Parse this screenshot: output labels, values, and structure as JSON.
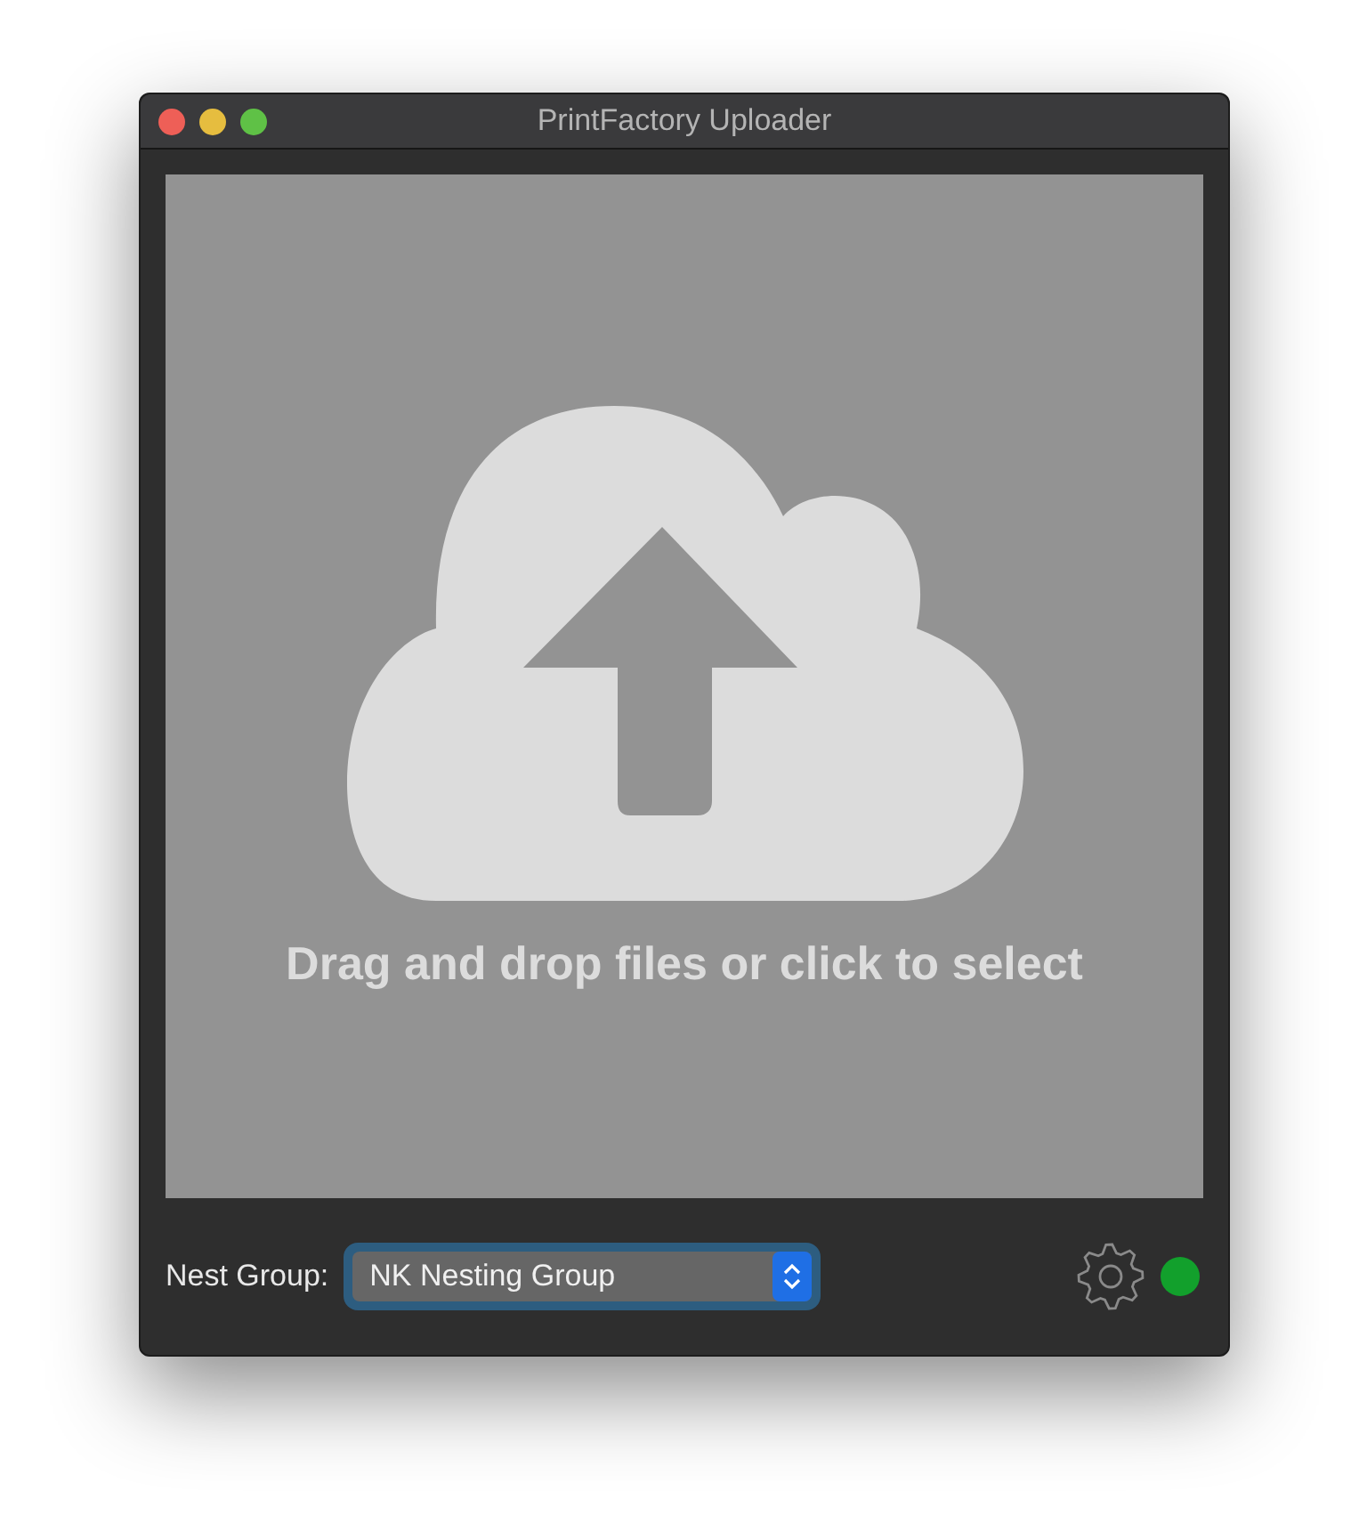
{
  "window": {
    "title": "PrintFactory Uploader"
  },
  "drop_zone": {
    "text": "Drag and drop files or click to select"
  },
  "nest_group": {
    "label": "Nest Group:",
    "value": "NK Nesting Group",
    "focused": true
  },
  "status": {
    "color": "#12a02c"
  }
}
